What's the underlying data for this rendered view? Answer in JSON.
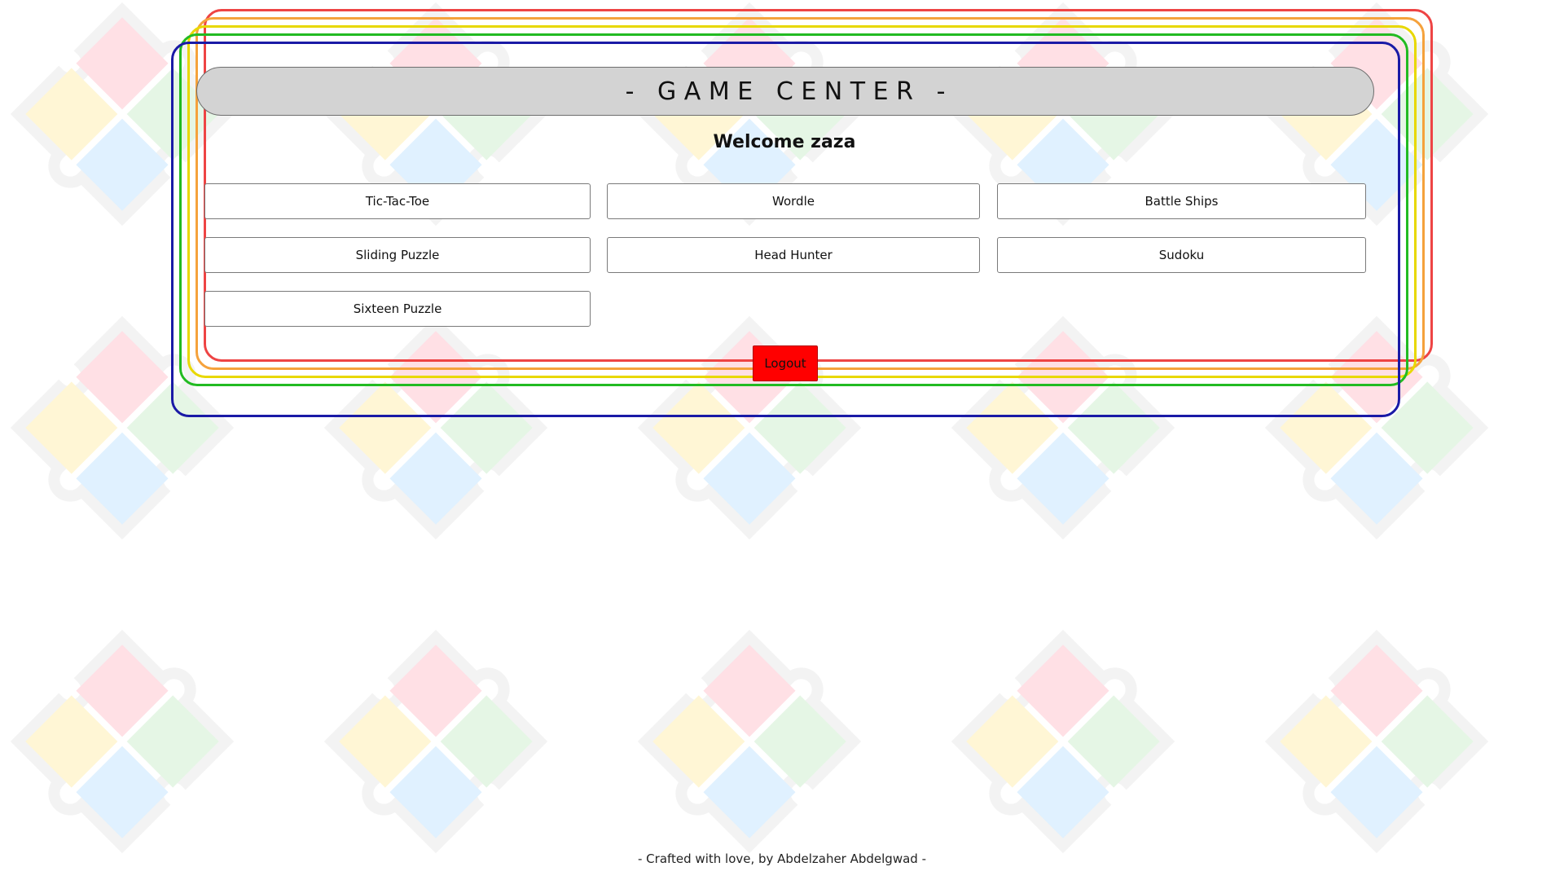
{
  "header": {
    "title": "-   G A M E   C E N T E R   -"
  },
  "welcome": {
    "text": "Welcome zaza"
  },
  "games": [
    {
      "label": "Tic-Tac-Toe"
    },
    {
      "label": "Wordle"
    },
    {
      "label": "Battle Ships"
    },
    {
      "label": "Sliding Puzzle"
    },
    {
      "label": "Head Hunter"
    },
    {
      "label": "Sudoku"
    },
    {
      "label": "Sixteen Puzzle"
    }
  ],
  "logout": {
    "label": "Logout",
    "color": "#ff0000"
  },
  "footer": {
    "text": "- Crafted with love, by Abdelzaher Abdelgwad -"
  },
  "colors": {
    "frame_red": "#ee4444",
    "frame_orange": "#f5a23c",
    "frame_yellow": "#e8d800",
    "frame_green": "#22bb22",
    "frame_blue": "#1a1aa6",
    "header_bg": "#d3d3d3"
  },
  "background": {
    "pattern": "puzzle-piece-icon"
  }
}
